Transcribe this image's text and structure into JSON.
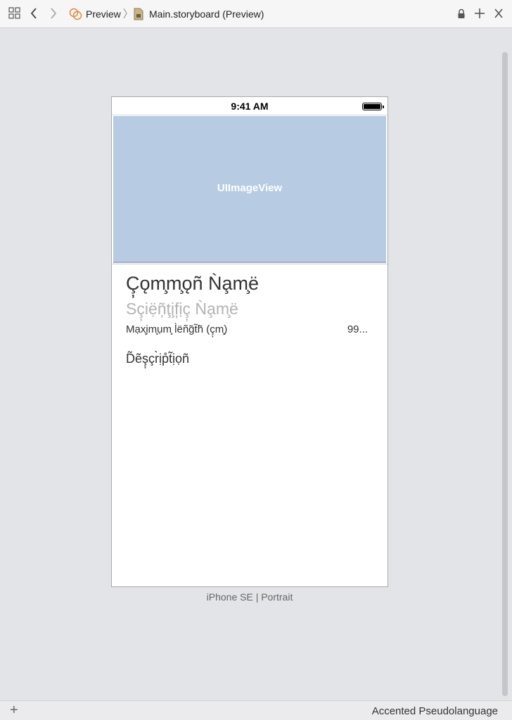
{
  "toolbar": {
    "breadcrumb_1": "Preview",
    "breadcrumb_2": "Main.storyboard (Preview)"
  },
  "device": {
    "status_time": "9:41 AM",
    "image_view_label": "UIImageView",
    "common_name": "Ç̦ǫm̧m̧ǫñ Ǹa̧m̧ë",
    "scientific_name": "Sç̦iẹ̈ņ̃ţi̧f̦ịç̦ Ǹa̧m̧ë",
    "max_length_label": "Mạx̧ịm̧ụm̧ l̀ëñg̃t̃h̃ (ç̦m̧)",
    "max_length_value": "99...",
    "description": "D̃ẽş̦çr̀ịp̊t̃ịọñ",
    "label": "iPhone SE | Portrait"
  },
  "footer": {
    "language": "Accented Pseudolanguage"
  }
}
